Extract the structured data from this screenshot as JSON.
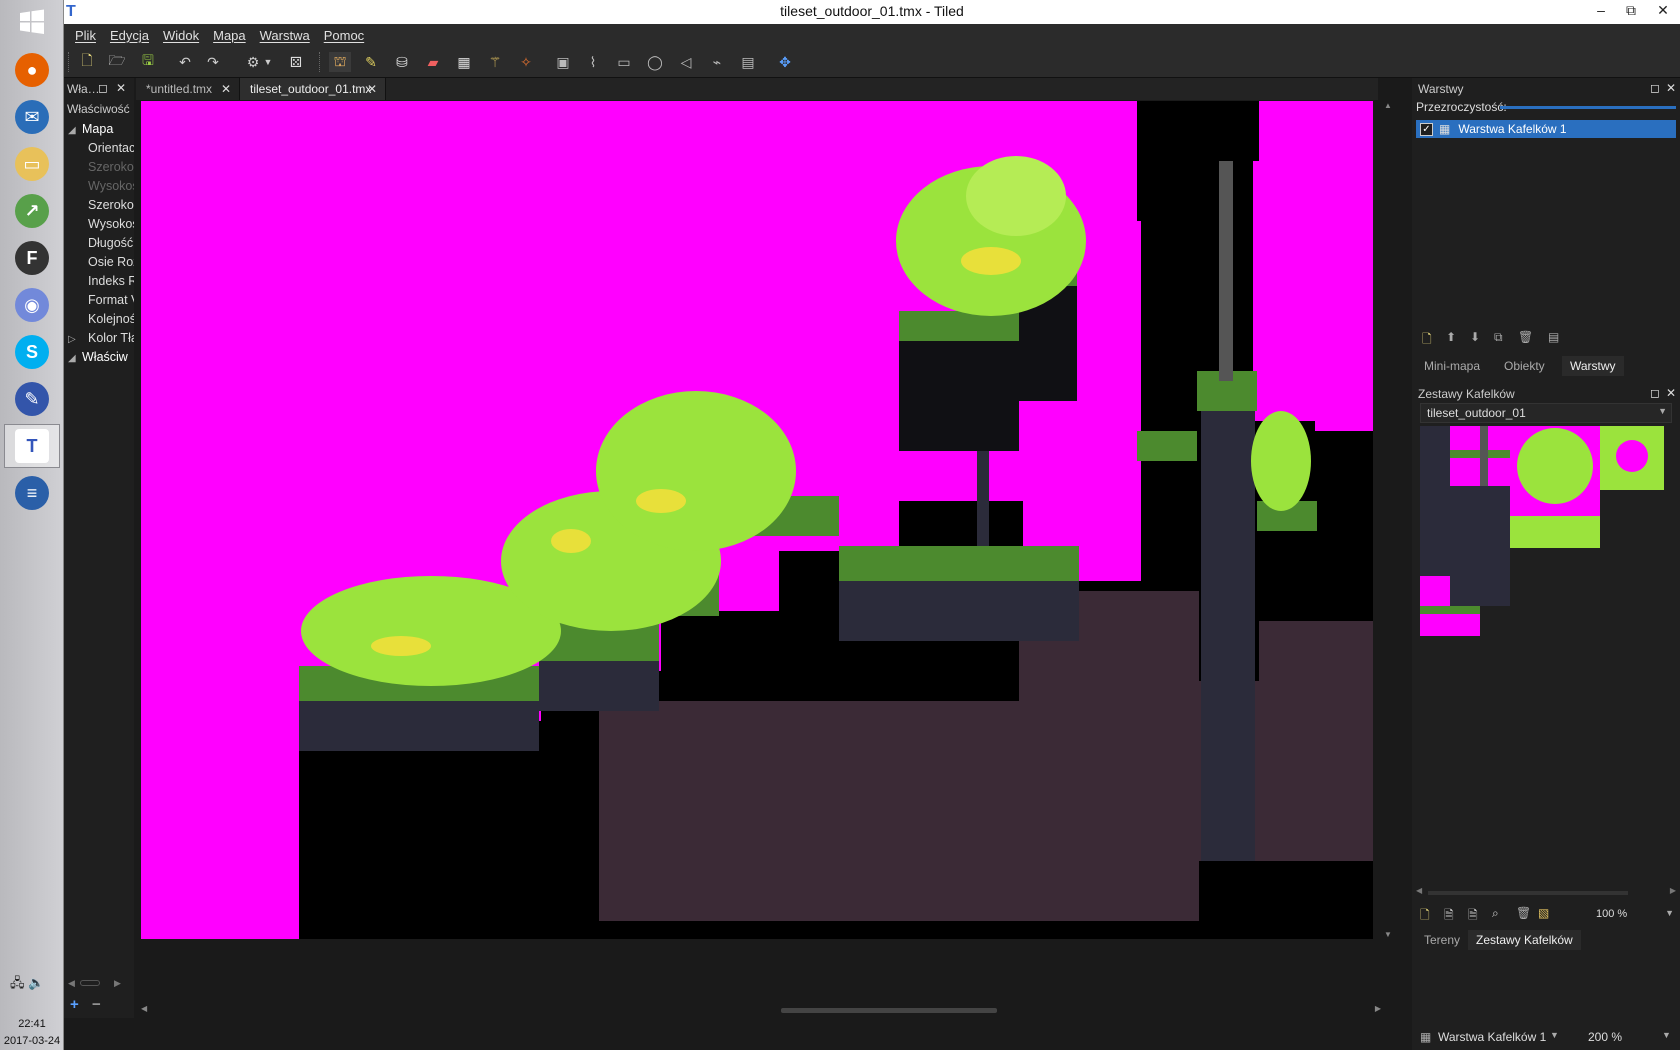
{
  "taskbar": {
    "clock_time": "22:41",
    "clock_date": "2017-03-24",
    "apps": [
      {
        "name": "firefox",
        "color": "#e66000",
        "glyph": "●"
      },
      {
        "name": "thunderbird",
        "color": "#2a6db8",
        "glyph": "✉"
      },
      {
        "name": "file-explorer",
        "color": "#e8c15a",
        "glyph": "▭"
      },
      {
        "name": "chart-app",
        "color": "#58a04a",
        "glyph": "↗"
      },
      {
        "name": "f-app",
        "color": "#333333",
        "glyph": "F"
      },
      {
        "name": "discord",
        "color": "#7289da",
        "glyph": "◉"
      },
      {
        "name": "skype",
        "color": "#00aff0",
        "glyph": "S"
      },
      {
        "name": "paint-app",
        "color": "#3355aa",
        "glyph": "✎"
      },
      {
        "name": "tiled",
        "color": "#ffffff",
        "glyph": "T"
      },
      {
        "name": "writer",
        "color": "#2a5fa8",
        "glyph": "≡"
      }
    ]
  },
  "window": {
    "title": "tileset_outdoor_01.tmx - Tiled",
    "minimize": "–",
    "restore": "⧉",
    "close": "✕"
  },
  "menu": [
    "Plik",
    "Edycja",
    "Widok",
    "Mapa",
    "Warstwa",
    "Pomoc"
  ],
  "properties_panel": {
    "header": "Wła…",
    "column_header": "Właściwość",
    "rows": [
      {
        "type": "group",
        "expanded": true,
        "label": "Mapa"
      },
      {
        "type": "item",
        "label": "Orientac"
      },
      {
        "type": "dim",
        "label": "Szerokoś"
      },
      {
        "type": "dim",
        "label": "Wysokoś"
      },
      {
        "type": "item",
        "label": "Szerokoś"
      },
      {
        "type": "item",
        "label": "Wysokoś"
      },
      {
        "type": "item",
        "label": "Długość"
      },
      {
        "type": "item",
        "label": "Osie Roz"
      },
      {
        "type": "item",
        "label": "Indeks R"
      },
      {
        "type": "item",
        "label": "Format V"
      },
      {
        "type": "item",
        "label": "Kolejnoś"
      },
      {
        "type": "item",
        "label": "Kolor Tła",
        "collapsed": true
      },
      {
        "type": "group",
        "expanded": true,
        "label": "Właściw"
      }
    ]
  },
  "doc_tabs": [
    {
      "label": "*untitled.tmx",
      "active": false
    },
    {
      "label": "tileset_outdoor_01.tmx",
      "active": true
    }
  ],
  "layers_panel": {
    "title": "Warstwy",
    "opacity_label": "Przezroczystość:",
    "layers": [
      {
        "name": "Warstwa Kafelków 1",
        "visible": true,
        "selected": true
      }
    ],
    "tabs": [
      "Mini-mapa",
      "Obiekty",
      "Warstwy"
    ],
    "active_tab": "Warstwy"
  },
  "tilesets_panel": {
    "title": "Zestawy Kafelków",
    "selected_tileset": "tileset_outdoor_01",
    "zoom": "100 %",
    "tabs": [
      "Tereny",
      "Zestawy Kafelków"
    ],
    "active_tab": "Zestawy Kafelków"
  },
  "statusbar": {
    "current_layer": "Warstwa Kafelków 1",
    "zoom": "200 %"
  },
  "colors": {
    "magenta": "#ff00ff",
    "grass_light": "#9be33d",
    "grass_yellow": "#e8e03a",
    "grass_dark": "#4c8a2e",
    "soil_dark": "#2b2b3a",
    "cave": "#3b2a36",
    "selection": "#2a6fbf"
  }
}
